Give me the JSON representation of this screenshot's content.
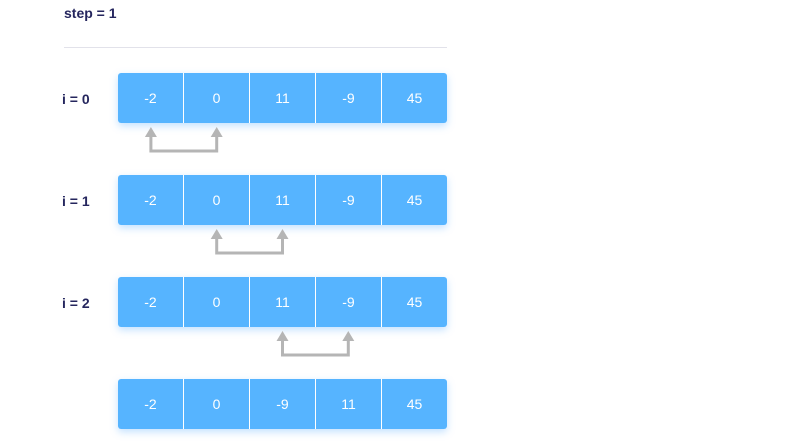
{
  "title": "step = 1",
  "rows": [
    {
      "label": "i = 0",
      "values": [
        "-2",
        "0",
        "11",
        "-9",
        "45"
      ],
      "compare": [
        0,
        1
      ]
    },
    {
      "label": "i = 1",
      "values": [
        "-2",
        "0",
        "11",
        "-9",
        "45"
      ],
      "compare": [
        1,
        2
      ]
    },
    {
      "label": "i = 2",
      "values": [
        "-2",
        "0",
        "11",
        "-9",
        "45"
      ],
      "compare": [
        2,
        3
      ]
    },
    {
      "label": "",
      "values": [
        "-2",
        "0",
        "-9",
        "11",
        "45"
      ],
      "compare": null
    }
  ],
  "colors": {
    "cell": "#56b4ff",
    "cell_text": "#ffffff",
    "label_text": "#25265e",
    "arrow": "#b5b5b5"
  }
}
